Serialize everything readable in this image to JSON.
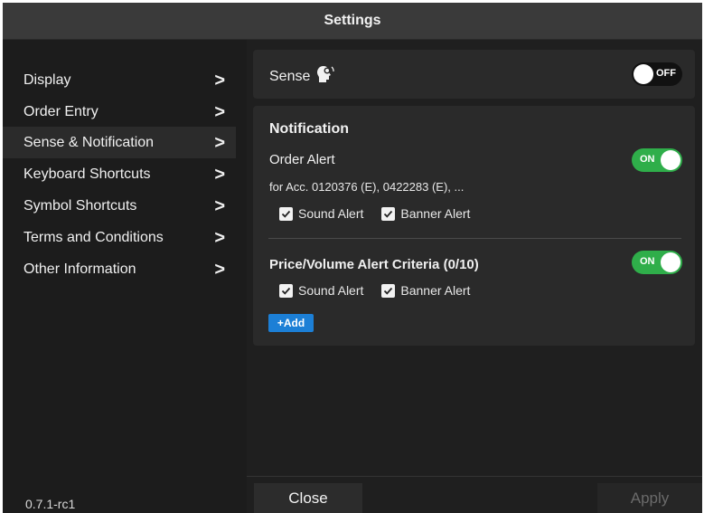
{
  "window": {
    "title": "Settings"
  },
  "sidebar": {
    "items": [
      {
        "label": "Display"
      },
      {
        "label": "Order Entry"
      },
      {
        "label": "Sense & Notification",
        "active": true
      },
      {
        "label": "Keyboard Shortcuts"
      },
      {
        "label": "Symbol Shortcuts"
      },
      {
        "label": "Terms and Conditions"
      },
      {
        "label": "Other Information"
      }
    ],
    "chevron": ">",
    "version": "0.7.1-rc1"
  },
  "sense": {
    "label": "Sense",
    "icon": "head-brain-icon",
    "toggle_text": "OFF",
    "enabled": false
  },
  "notification": {
    "heading": "Notification",
    "order_alert": {
      "label": "Order Alert",
      "toggle_text": "ON",
      "enabled": true,
      "accounts": "for Acc. 0120376 (E), 0422283 (E), ...",
      "sound_alert": "Sound Alert",
      "banner_alert": "Banner Alert",
      "sound_checked": true,
      "banner_checked": true
    },
    "price_volume": {
      "label": "Price/Volume Alert Criteria (0/10)",
      "toggle_text": "ON",
      "enabled": true,
      "sound_alert": "Sound Alert",
      "banner_alert": "Banner Alert",
      "sound_checked": true,
      "banner_checked": true,
      "add_label": "+Add"
    }
  },
  "footer": {
    "close_label": "Close",
    "apply_label": "Apply"
  },
  "colors": {
    "accent_on": "#2fae4a",
    "add_button": "#1c7fd6",
    "background": "#1c1c1c",
    "panel": "#2a2a2a"
  }
}
